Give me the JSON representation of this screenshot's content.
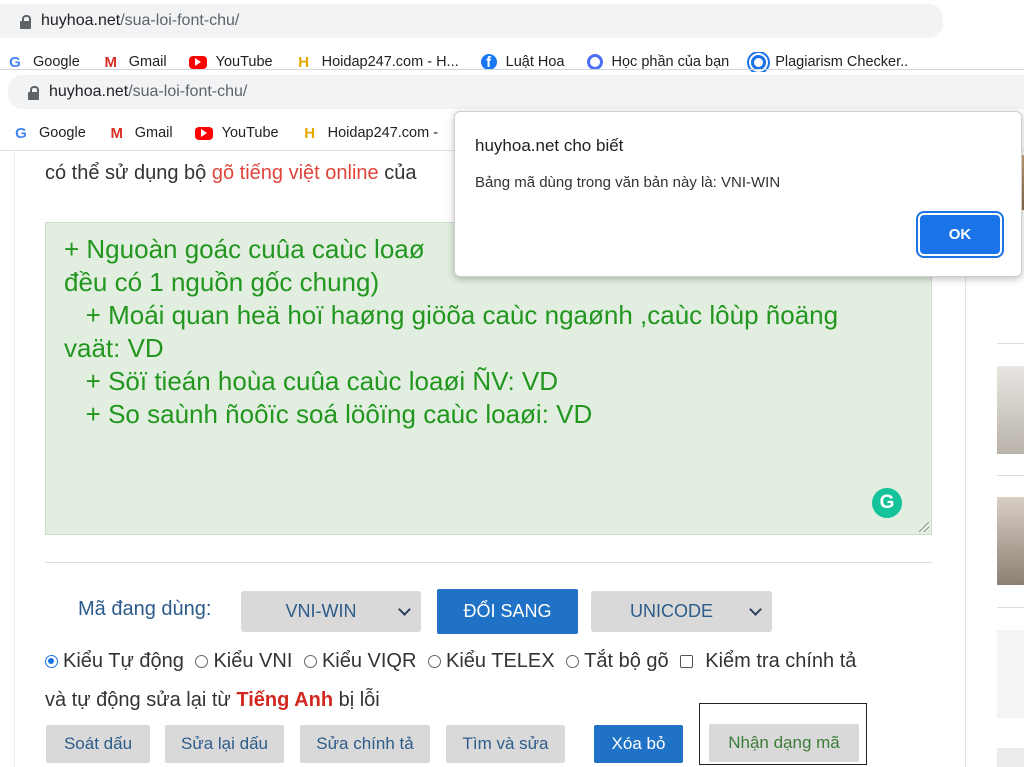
{
  "browser_back": {
    "url_domain": "huyhoa.net",
    "url_path": "/sua-loi-font-chu/",
    "bookmarks": [
      {
        "icon": "google-icon",
        "label": "Google"
      },
      {
        "icon": "gmail-icon",
        "label": "Gmail"
      },
      {
        "icon": "youtube-icon",
        "label": "YouTube"
      },
      {
        "icon": "hoidap-icon",
        "label": "Hoidap247.com - H..."
      },
      {
        "icon": "facebook-icon",
        "label": "Luật Hoa"
      },
      {
        "icon": "ring-icon",
        "label": "Học phần của bạn"
      },
      {
        "icon": "target-icon",
        "label": "Plagiarism Checker.."
      }
    ]
  },
  "browser_front": {
    "url_domain": "huyhoa.net",
    "url_path": "/sua-loi-font-chu/",
    "bookmarks": [
      {
        "icon": "google-icon",
        "label": "Google"
      },
      {
        "icon": "gmail-icon",
        "label": "Gmail"
      },
      {
        "icon": "youtube-icon",
        "label": "YouTube"
      },
      {
        "icon": "hoidap-icon",
        "label": "Hoidap247.com -"
      }
    ]
  },
  "page": {
    "intro_prefix": "có thể sử dụng bộ ",
    "intro_link": "gõ tiếng việt online",
    "intro_suffix": " của",
    "editor_text": "+ Nguoàn goác cuûa caùc loaø\nđều có 1 nguồn gốc chung)\n   + Moái quan heä hoï haøng giöõa caùc ngaønh ,caùc lôùp ñoäng\nvaät: VD\n   + Söï tieán hoùa cuûa caùc loaøi ÑV: VD\n   + So saùnh ñoôïc soá löôïng caùc loaøi: VD",
    "grammarly_label": "G",
    "encoding_label": "Mã đang dùng:",
    "source_encoding": "VNI-WIN",
    "convert_button": "ĐỔI SANG",
    "target_encoding": "UNICODE",
    "options": [
      {
        "label": "Kiểu Tự động",
        "checked": true
      },
      {
        "label": "Kiểu VNI",
        "checked": false
      },
      {
        "label": "Kiểu VIQR",
        "checked": false
      },
      {
        "label": "Kiểu TELEX",
        "checked": false
      },
      {
        "label": "Tắt bộ gõ",
        "checked": false
      }
    ],
    "spellcheck_label": "Kiểm tra chính tả",
    "spellcheck_line2_prefix": "và tự động sửa lại từ ",
    "spellcheck_highlight": "Tiếng Anh",
    "spellcheck_line2_suffix": " bị lỗi",
    "tools": [
      "Soát dấu",
      "Sửa lại dấu",
      "Sửa chính tả",
      "Tìm và sửa",
      "Xóa bỏ",
      "Nhận dạng mã"
    ]
  },
  "dialog": {
    "title": "huyhoa.net cho biết",
    "message": "Bảng mã dùng trong văn bản này là: VNI-WIN",
    "ok_label": "OK"
  }
}
